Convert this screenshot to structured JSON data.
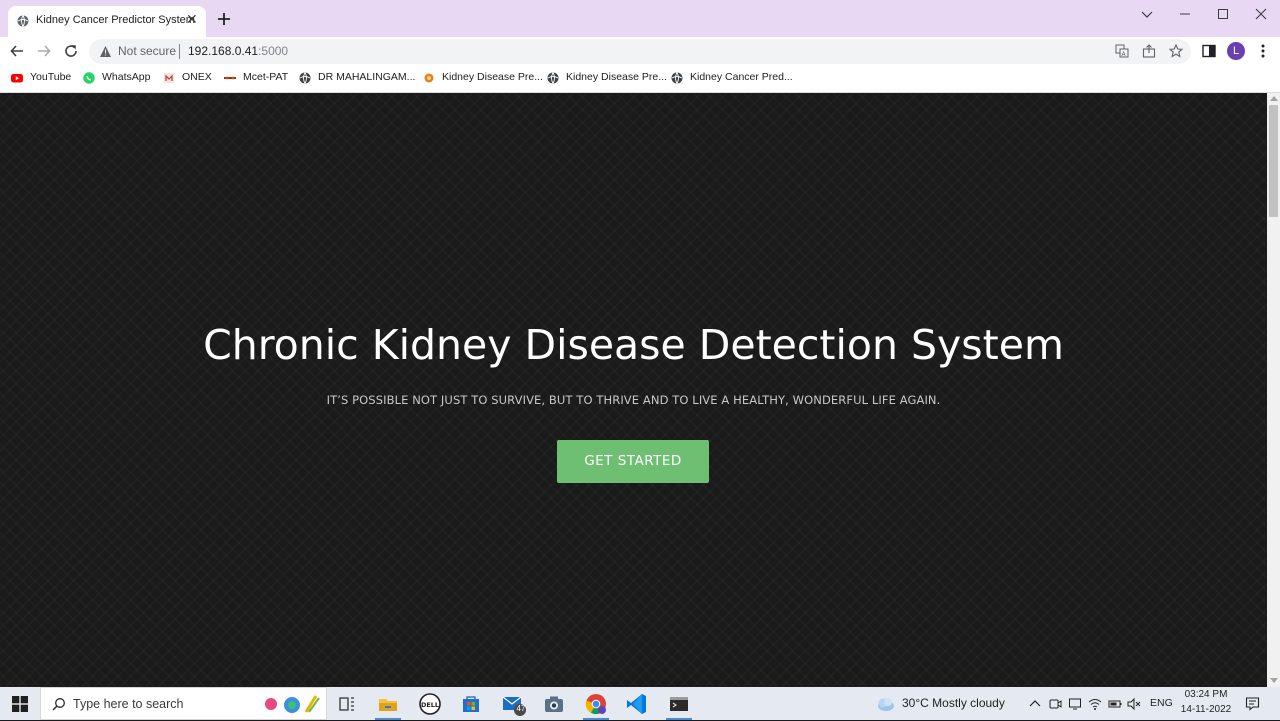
{
  "browser": {
    "tab": {
      "title": "Kidney Cancer Predictor System"
    },
    "address": {
      "security_label": "Not secure",
      "host": "192.168.0.41",
      "port": ":5000"
    },
    "profile_initial": "L",
    "bookmarks": [
      {
        "label": "YouTube",
        "icon": "youtube-icon"
      },
      {
        "label": "WhatsApp",
        "icon": "whatsapp-icon"
      },
      {
        "label": "ONEX",
        "icon": "onex-icon"
      },
      {
        "label": "Mcet-PAT",
        "icon": "mcet-icon"
      },
      {
        "label": "DR MAHALINGAM...",
        "icon": "globe-icon"
      },
      {
        "label": "Kidney Disease Pre...",
        "icon": "kidney-icon"
      },
      {
        "label": "Kidney Disease Pre...",
        "icon": "globe-icon"
      },
      {
        "label": "Kidney Cancer Pred...",
        "icon": "globe-icon"
      }
    ]
  },
  "page": {
    "title": "Chronic Kidney Disease Detection System",
    "subtitle": "IT’S POSSIBLE NOT JUST TO SURVIVE, BUT TO THRIVE AND TO LIVE A HEALTHY, WONDERFUL LIFE AGAIN.",
    "cta_label": "GET STARTED"
  },
  "taskbar": {
    "search_placeholder": "Type here to search",
    "mail_badge": "47",
    "weather": "30°C  Mostly cloudy",
    "language": "ENG",
    "time": "03:24 PM",
    "date": "14-11-2022"
  },
  "colors": {
    "titlebar": "#e9d8f3",
    "page_background": "#1a1a1a",
    "cta_background": "#6fbf73",
    "avatar": "#6a3fb5"
  }
}
